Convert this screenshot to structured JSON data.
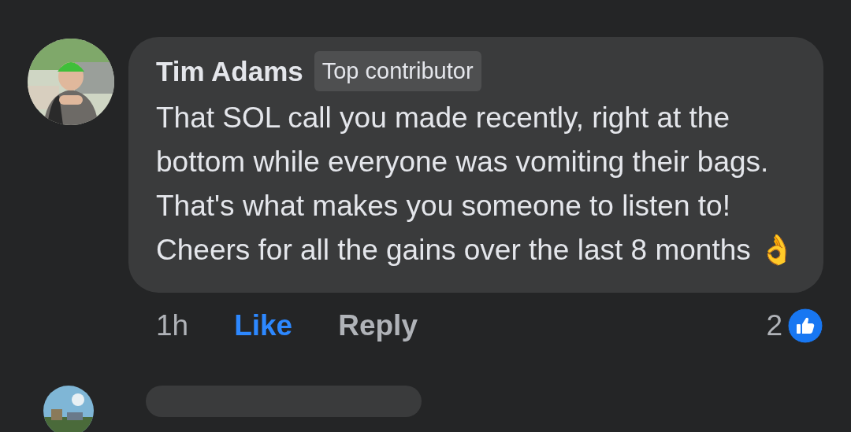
{
  "comment": {
    "author": "Tim Adams",
    "badge": "Top contributor",
    "text": "That SOL call you made recently, right at the bottom while everyone was vomiting their bags. That's what makes you someone to listen to! Cheers for all the gains over the last 8 months 👌",
    "time": "1h",
    "actions": [
      {
        "label": "Like",
        "kind": "like"
      },
      {
        "label": "Reply",
        "kind": "reply"
      }
    ],
    "reaction_count": "2"
  }
}
